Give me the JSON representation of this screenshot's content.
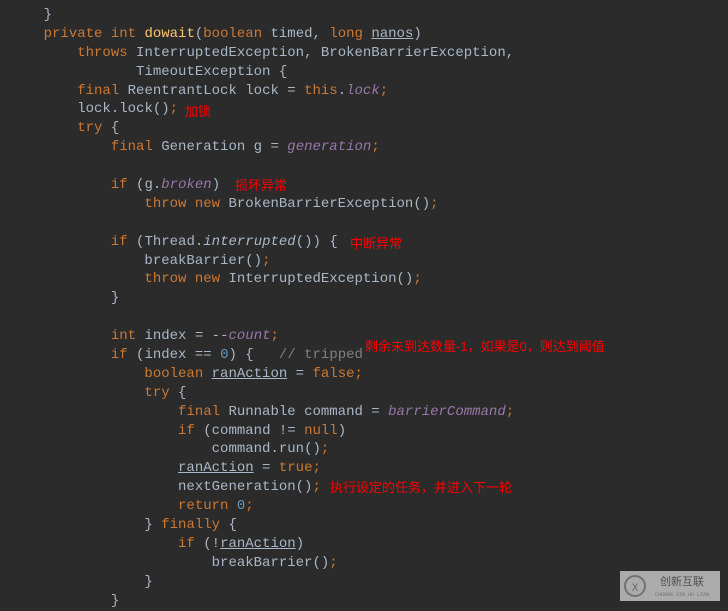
{
  "lines": {
    "l1": {
      "private": "private",
      "int": "int",
      "do_wait": "dowait",
      "boolean": "boolean",
      "timed": "timed",
      "long": "long",
      "nanos": "nanos"
    },
    "l2": {
      "throws": "throws",
      "ie": "InterruptedException",
      "bbe": "BrokenBarrierException"
    },
    "l3": {
      "te": "TimeoutException"
    },
    "l4": {
      "final": "final",
      "rl": "ReentrantLock",
      "lock": "lock",
      "eq": "=",
      "this": "this",
      "lock2": "lock"
    },
    "l5": {
      "lock": "lock",
      "call": "lock"
    },
    "l6": {
      "try": "try"
    },
    "l7": {
      "final": "final",
      "gen": "Generation",
      "g": "g",
      "eq": "=",
      "generation": "generation"
    },
    "l8": {
      "if": "if",
      "g": "g",
      "broken": "broken"
    },
    "l9": {
      "throw": "throw",
      "new": "new",
      "bbe": "BrokenBarrierException"
    },
    "l10": {
      "if": "if",
      "thread": "Thread",
      "interrupted": "interrupted"
    },
    "l11": {
      "bb": "breakBarrier"
    },
    "l12": {
      "throw": "throw",
      "new": "new",
      "ie": "InterruptedException"
    },
    "l13": {
      "int": "int",
      "index": "index",
      "count": "count"
    },
    "l14": {
      "if": "if",
      "index": "index",
      "zero": "0",
      "comment": "// tripped"
    },
    "l15": {
      "boolean": "boolean",
      "ran": "ranAction",
      "false": "false"
    },
    "l16": {
      "try": "try"
    },
    "l17": {
      "final": "final",
      "runnable": "Runnable",
      "command": "command",
      "bc": "barrierCommand"
    },
    "l18": {
      "if": "if",
      "command": "command",
      "null": "null"
    },
    "l19": {
      "command": "command",
      "run": "run"
    },
    "l20": {
      "ran": "ranAction",
      "true": "true"
    },
    "l21": {
      "ng": "nextGeneration"
    },
    "l22": {
      "return": "return",
      "zero": "0"
    },
    "l23": {
      "finally": "finally"
    },
    "l24": {
      "if": "if",
      "ran": "ranAction"
    },
    "l25": {
      "bb": "breakBarrier"
    }
  },
  "annotations": {
    "lock": "加锁",
    "broken": "损坏异常",
    "interrupt": "中断异常",
    "count": "剩余未到达数量-1，如果是0，则达到阈值",
    "next": "执行设定的任务，并进入下一轮"
  },
  "watermark": {
    "text": "创新互联",
    "sub": "CHUANG XIN HU LIAN"
  }
}
